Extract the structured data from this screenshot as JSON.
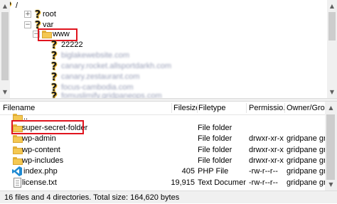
{
  "tree": {
    "root_path": "/",
    "nodes": [
      {
        "label": "root",
        "expander": "+"
      },
      {
        "label": "var",
        "expander": "−"
      },
      {
        "label": "www",
        "expander": "−"
      },
      {
        "label": "22222"
      },
      {
        "label": "biglakewebsite.com"
      },
      {
        "label": "canary.rocket.allsportdarkh.com"
      },
      {
        "label": "canary.zestaurant.com"
      },
      {
        "label": "focus-cambodia.com"
      },
      {
        "label": "fomuslimify.gridpaneops.com"
      }
    ]
  },
  "list": {
    "columns": [
      "Filename",
      "Filesize",
      "Filetype",
      "Permissio...",
      "Owner/Group"
    ],
    "rows": [
      {
        "name": "..",
        "size": "",
        "type": "",
        "perms": "",
        "owner": "",
        "icon": "folder-icon"
      },
      {
        "name": "super-secret-folder",
        "size": "",
        "type": "File folder",
        "perms": "",
        "owner": "",
        "icon": "folder-icon"
      },
      {
        "name": "wp-admin",
        "size": "",
        "type": "File folder",
        "perms": "drwxr-xr-x",
        "owner": "gridpane gri...",
        "icon": "folder-icon"
      },
      {
        "name": "wp-content",
        "size": "",
        "type": "File folder",
        "perms": "drwxr-xr-x",
        "owner": "gridpane gri...",
        "icon": "folder-icon"
      },
      {
        "name": "wp-includes",
        "size": "",
        "type": "File folder",
        "perms": "drwxr-xr-x",
        "owner": "gridpane gri...",
        "icon": "folder-icon"
      },
      {
        "name": "index.php",
        "size": "405",
        "type": "PHP File",
        "perms": "-rw-r--r--",
        "owner": "gridpane gri...",
        "icon": "vscode-php-icon"
      },
      {
        "name": "license.txt",
        "size": "19,915",
        "type": "Text Document",
        "perms": "-rw-r--r--",
        "owner": "gridpane gri...",
        "icon": "text-document-icon"
      }
    ]
  },
  "status": {
    "text": "16 files and 4 directories. Total size: 164,620 bytes"
  },
  "colors": {
    "highlight_border": "#e0141e",
    "folder": "#f4c852",
    "question_mark": "#f2c230",
    "vscode_blue": "#1f8ad2"
  }
}
